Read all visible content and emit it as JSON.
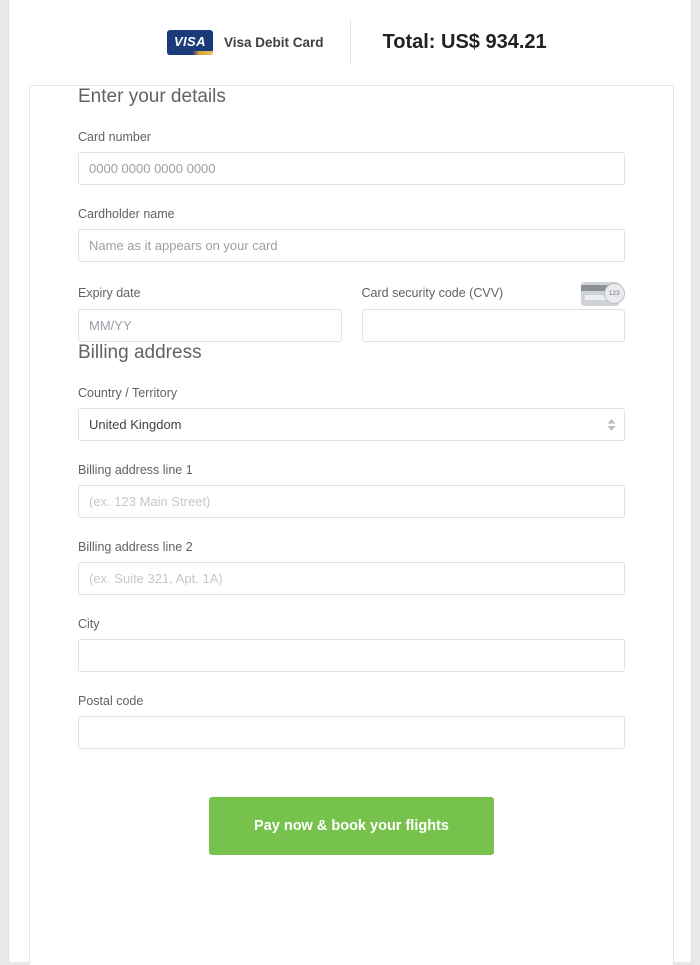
{
  "header": {
    "card_brand_logo_text": "VISA",
    "card_brand_name": "Visa Debit Card",
    "total_label": "Total: US$ 934.21"
  },
  "colors": {
    "brand_blue": "#1a3a7a",
    "brand_gold": "#e8c05a",
    "cta_green": "#76c24c",
    "border_grey": "#dfe1e5",
    "label_grey": "#5f6368",
    "placeholder_grey": "#9aa0a6"
  },
  "details_section": {
    "title": "Enter your details",
    "card_number": {
      "label": "Card number",
      "placeholder": "0000 0000 0000 0000",
      "value": ""
    },
    "cardholder_name": {
      "label": "Cardholder name",
      "placeholder": "Name as it appears on your card",
      "value": ""
    },
    "expiry_date": {
      "label": "Expiry date",
      "placeholder": "MM/YY",
      "value": ""
    },
    "cvv": {
      "label": "Card security code (CVV)",
      "placeholder": "",
      "value": "",
      "icon": "credit-card-back-cvv-icon",
      "icon_digits": "123"
    }
  },
  "billing_section": {
    "title": "Billing address",
    "country": {
      "label": "Country / Territory",
      "value": "United Kingdom",
      "icon": "select-spinner-icon"
    },
    "address_line_1": {
      "label": "Billing address line 1",
      "placeholder": "(ex. 123 Main Street)",
      "value": ""
    },
    "address_line_2": {
      "label": "Billing address line 2",
      "placeholder": "(ex. Suite 321, Apt. 1A)",
      "value": ""
    },
    "city": {
      "label": "City",
      "placeholder": "",
      "value": ""
    },
    "postal_code": {
      "label": "Postal code",
      "placeholder": "",
      "value": ""
    }
  },
  "footer": {
    "pay_button_label": "Pay now & book your flights"
  }
}
